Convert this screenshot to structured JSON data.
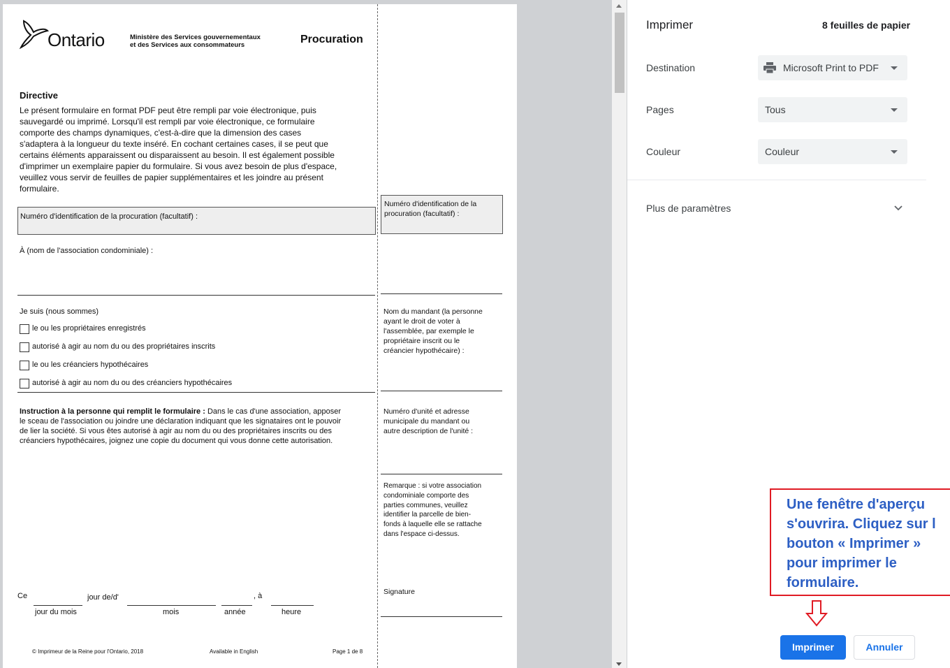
{
  "document": {
    "logo_text": "Ontario",
    "ministry": "Ministère des Services gouvernementaux\net des Services aux consommateurs",
    "form_title": "Procuration",
    "directive_heading": "Directive",
    "directive_lines": [
      "Le présent formulaire en format PDF peut être rempli par voie électronique, puis",
      "sauvegardé ou imprimé. Lorsqu'il est rempli par voie électronique, ce formulaire",
      "comporte des champs dynamiques, c'est-à-dire que la dimension des cases",
      "s'adaptera à la longueur du texte inséré. En cochant certaines cases, il se peut que",
      "certains éléments apparaissent ou disparaissent au besoin. Il est également possible",
      "d'imprimer un exemplaire papier du formulaire. Si vous avez besoin de plus d'espace,",
      "veuillez vous servir de feuilles de papier supplémentaires et les joindre au présent",
      "formulaire."
    ],
    "id_field_label": "Numéro d'identification de la procuration (facultatif) :",
    "association_label": "À (nom de l'association condominiale) :",
    "je_suis_label": "Je suis (nous sommes)",
    "checkboxes": [
      "le ou les propriétaires enregistrés",
      "autorisé à agir au nom du ou des propriétaires inscrits",
      "le ou les créanciers hypothécaires",
      "autorisé à agir au nom du ou des créanciers hypothécaires"
    ],
    "instruction_bold": "Instruction à la personne qui remplit le formulaire :",
    "instruction_lines": [
      " Dans le cas d'une association, apposer",
      "le sceau de l'association ou joindre une déclaration indiquant que les signataires ont le pouvoir",
      "de lier la société. Si vous êtes autorisé à agir au nom du ou des propriétaires inscrits ou des",
      "créanciers hypothécaires, joignez une copie du document qui vous donne cette autorisation."
    ],
    "date_row": {
      "ce": "Ce",
      "jour_de": "jour de/d'",
      "a": ", à",
      "jour_du_mois": "jour du mois",
      "mois": "mois",
      "annee": "année",
      "heure": "heure"
    },
    "footer": {
      "copyright": "© Imprimeur de la Reine pour l'Ontario, 2018",
      "available": "Available in English",
      "page": "Page 1 de 8"
    },
    "right_col": {
      "id_label": "Numéro d'identification de la\nprocuration (facultatif) :",
      "mandant_label": "Nom du mandant (la personne\nayant le droit de voter à\nl'assemblée, par exemple le\npropriétaire inscrit ou le\ncréancier hypothécaire) :",
      "unite_label": "Numéro d'unité et adresse\nmunicipale du mandant ou\nautre description de l'unité :",
      "remarque": "Remarque : si votre association\ncondominiale comporte des\nparties communes, veuillez\nidentifier la parcelle de bien-\nfonds à laquelle elle se rattache\ndans l'espace ci-dessus.",
      "signature": "Signature"
    }
  },
  "panel": {
    "title": "Imprimer",
    "sheets": "8 feuilles de papier",
    "destination_label": "Destination",
    "destination_value": "Microsoft Print to PDF",
    "pages_label": "Pages",
    "pages_value": "Tous",
    "color_label": "Couleur",
    "color_value": "Couleur",
    "more_settings": "Plus de paramètres",
    "print_button": "Imprimer",
    "cancel_button": "Annuler"
  },
  "callout": {
    "text": "Une fenêtre d'aperçu\ns'ouvrira. Cliquez sur l\nbouton « Imprimer »\npour imprimer le\nformulaire."
  },
  "colors": {
    "accent": "#1a73e8",
    "callout_border": "#e01b24",
    "callout_text": "#2d5fc4"
  }
}
